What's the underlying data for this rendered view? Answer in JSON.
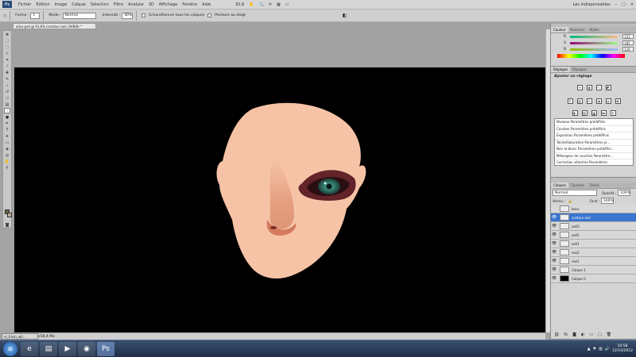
{
  "menubar": {
    "logo": "Ps",
    "items": [
      "Fichier",
      "Edition",
      "Image",
      "Calque",
      "Sélection",
      "Filtre",
      "Analyse",
      "3D",
      "Affichage",
      "Fenêtre",
      "Aide"
    ],
    "zoom": "91,6",
    "workspace": "Les indispensables"
  },
  "options": {
    "forme_label": "Forme :",
    "forme_value": "1",
    "mode_label": "Mode :",
    "mode_value": "Normal",
    "intensite_label": "Intensité :",
    "intensite_value": "40%",
    "sample_all_label": "Echantillonner tous les calques",
    "finger_paint_label": "Peinture au doigt"
  },
  "document": {
    "tab_title": "alice.psd @ 91,6% (contour oeil, RVB/8) *",
    "status": "Doc : 3,30 Mo/18,4 Mo"
  },
  "color_panel": {
    "tabs": [
      "Couleur",
      "Nuancier",
      "Styles"
    ],
    "channels": [
      {
        "name": "R",
        "value": "152"
      },
      {
        "name": "V",
        "value": "185"
      },
      {
        "name": "B",
        "value": "129"
      }
    ]
  },
  "adjust_panel": {
    "tabs": [
      "Réglages",
      "Masques"
    ],
    "title": "Ajouter un réglage",
    "presets": [
      "Niveaux Paramètres prédéfinis",
      "Courbes Paramètres prédéfinis",
      "Exposition Paramètres prédéfinis",
      "Teinte/Saturation Paramètres pr...",
      "Noir et blanc Paramètres prédéfini...",
      "Mélangeur de couches Paramètre...",
      "Correction sélective Paramètres"
    ]
  },
  "layers_panel": {
    "tabs": [
      "Calques",
      "Couches",
      "Tracés"
    ],
    "blend_mode": "Normal",
    "opacity_label": "Opacité :",
    "opacity_value": "100%",
    "lock_label": "Verrou :",
    "fill_label": "Fond :",
    "fill_value": "100%",
    "layers": [
      {
        "name": "bouc",
        "visible": false,
        "selected": false
      },
      {
        "name": "contour oeil",
        "visible": true,
        "selected": true
      },
      {
        "name": "oeil3",
        "visible": true,
        "selected": false
      },
      {
        "name": "oeil2",
        "visible": true,
        "selected": false
      },
      {
        "name": "oeil1",
        "visible": true,
        "selected": false
      },
      {
        "name": "nez2",
        "visible": true,
        "selected": false
      },
      {
        "name": "nez1",
        "visible": true,
        "selected": false
      },
      {
        "name": "Calque 1",
        "visible": true,
        "selected": false
      },
      {
        "name": "Calque 0",
        "visible": true,
        "selected": false
      }
    ]
  },
  "taskbar": {
    "mini_window": "m_frozn_wit...",
    "time": "10:58",
    "date": "12/10/2012"
  },
  "colors": {
    "skin": "#f6c3a6",
    "selection": "#3a75d0",
    "eye_iris": "#3f8f7d"
  }
}
